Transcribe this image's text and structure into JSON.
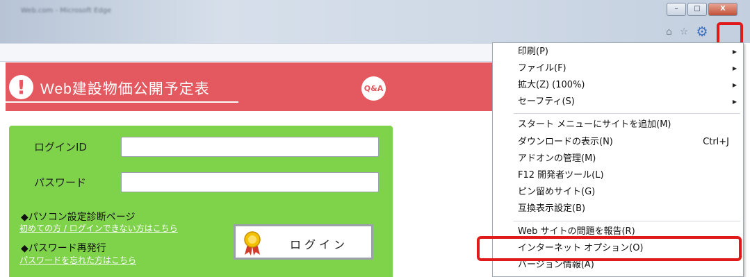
{
  "window": {
    "title": "Web.com - Microsoft Edge",
    "minimize_glyph": "–",
    "maximize_glyph": "□",
    "close_glyph": "X"
  },
  "toolbar_icons": [
    "home-icon",
    "star-icon",
    "gear-icon"
  ],
  "toolbar_glyphs": {
    "home": "⌂",
    "star": "☆",
    "gear": "⚙"
  },
  "banner": {
    "icon_glyph": "!",
    "title": "Web建設物価公開予定表",
    "qa_label": "Q&A",
    "color": "#e4585f"
  },
  "login": {
    "panel_color": "#7fd34b",
    "id_label": "ログインID",
    "id_value": "",
    "password_label": "パスワード",
    "password_value": "",
    "diagnosis_heading": "◆パソコン設定診断ページ",
    "diagnosis_link": "初めての方 / ログインできない方はこちら",
    "reissue_heading": "◆パスワード再発行",
    "reissue_link": "パスワードを忘れた方はこちら",
    "login_button": "ログイン"
  },
  "menu": {
    "items": [
      {
        "label": "印刷(P)",
        "submenu": true
      },
      {
        "label": "ファイル(F)",
        "submenu": true
      },
      {
        "label": "拡大(Z) (100%)",
        "submenu": true
      },
      {
        "label": "セーフティ(S)",
        "submenu": true
      },
      {
        "label": "スタート メニューにサイトを追加(M)"
      },
      {
        "label": "ダウンロードの表示(N)",
        "shortcut": "Ctrl+J"
      },
      {
        "label": "アドオンの管理(M)"
      },
      {
        "label": "F12 開発者ツール(L)"
      },
      {
        "label": "ピン留めサイト(G)"
      },
      {
        "label": "互換表示設定(B)"
      },
      {
        "label": "Web サイトの問題を報告(R)"
      },
      {
        "label": "インターネット オプション(O)",
        "highlighted": true
      },
      {
        "label": "バージョン情報(A)"
      }
    ],
    "arrow_glyph": "▶",
    "highlight_color": "#e01a1a"
  }
}
